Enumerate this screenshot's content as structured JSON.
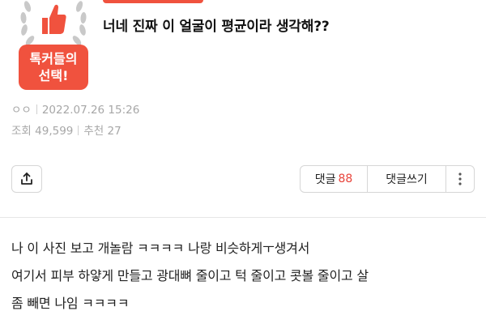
{
  "badge": {
    "line1": "톡커들의",
    "line2": "선택!"
  },
  "post": {
    "title": "너네 진짜 이 얼굴이 평균이라 생각해??",
    "author": "ㅇㅇ",
    "date": "2022.07.26 15:26",
    "views_label": "조회",
    "views": "49,599",
    "likes_label": "추천",
    "likes": "27",
    "body": [
      "나 이 사진 보고 개놀람 ㅋㅋㅋㅋ 나랑 비슷하게ㅜ생겨서",
      "여기서 피부 하얗게 만들고 광대뼈 줄이고 턱 줄이고 콧볼 줄이고 살",
      "좀 빼면 나임 ㅋㅋㅋㅋ"
    ]
  },
  "actions": {
    "comments_label": "댓글",
    "comments_count": "88",
    "write_comment_label": "댓글쓰기"
  },
  "colors": {
    "accent": "#f0523e",
    "count": "#e8433a",
    "meta": "#a7a7a7"
  },
  "icons": [
    "thumbs-up-icon",
    "wreath-icon",
    "share-icon",
    "more-vertical-icon"
  ]
}
